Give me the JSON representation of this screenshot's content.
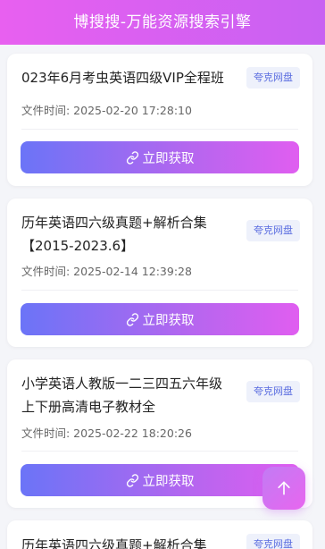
{
  "header": {
    "title": "博搜搜-万能资源搜索引擎"
  },
  "colors": {
    "accent_start": "#6b74f7",
    "accent_end": "#e05ef0",
    "badge_text": "#5a6de0"
  },
  "cards": [
    {
      "title": "023年6月考虫英语四级VIP全程班",
      "badge": "夸克网盘",
      "time": "文件时间: 2025-02-20 17:28:10",
      "button": "立即获取"
    },
    {
      "title": "历年英语四六级真题+解析合集【2015-2023.6】",
      "badge": "夸克网盘",
      "time": "文件时间: 2025-02-14 12:39:28",
      "button": "立即获取"
    },
    {
      "title": "小学英语人教版一二三四五六年级上下册高清电子教材全",
      "badge": "夸克网盘",
      "time": "文件时间: 2025-02-22 18:20:26",
      "button": "立即获取"
    },
    {
      "title": "历年英语四六级真题+解析合集",
      "badge": "夸克网盘"
    }
  ],
  "icons": {
    "link": "link-icon",
    "back_to_top": "arrow-up-icon"
  }
}
